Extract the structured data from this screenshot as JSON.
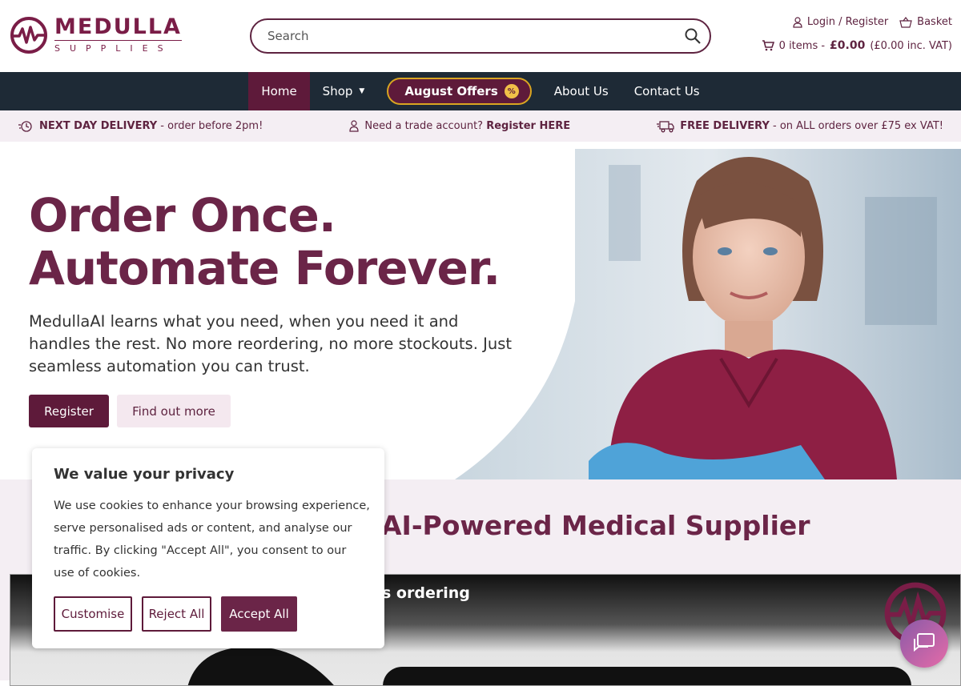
{
  "brand": {
    "name": "MEDULLA",
    "sub": "SUPPLIES",
    "color": "#7a1d47"
  },
  "search": {
    "placeholder": "Search"
  },
  "account": {
    "login": "Login / Register",
    "basket": "Basket"
  },
  "cart": {
    "items": "0 items -",
    "price": "£0.00",
    "vat": "(£0.00 inc. VAT)"
  },
  "nav": {
    "home": "Home",
    "shop": "Shop",
    "offers": "August Offers",
    "about": "About Us",
    "contact": "Contact Us"
  },
  "strip": {
    "delivery_bold": "NEXT DAY DELIVERY",
    "delivery_rest": " - order before 2pm!",
    "trade_text": "Need a trade account? ",
    "trade_bold": "Register HERE",
    "free_bold": "FREE DELIVERY",
    "free_rest": " - on ALL orders over £75 ex VAT!"
  },
  "hero": {
    "line1": "Order Once.",
    "line2": "Automate Forever.",
    "body": "MedullaAI learns what you need, when you need it and handles the rest. No more reordering, no more stockouts. Just seamless automation you can trust.",
    "register": "Register",
    "more": "Find out more"
  },
  "section2": {
    "title": "AI-Powered Medical Supplier",
    "video_title": "s ordering"
  },
  "cookie": {
    "title": "We value your privacy",
    "body": "We use cookies to enhance your browsing experience, serve personalised ads or content, and analyse our traffic. By clicking \"Accept All\", you consent to our use of cookies.",
    "customise": "Customise",
    "reject": "Reject All",
    "accept": "Accept All"
  },
  "icons": [
    "search-icon",
    "user-icon",
    "basket-icon",
    "cart-icon",
    "delivery-icon",
    "account-icon",
    "van-icon",
    "chat-icon",
    "percent-icon"
  ]
}
